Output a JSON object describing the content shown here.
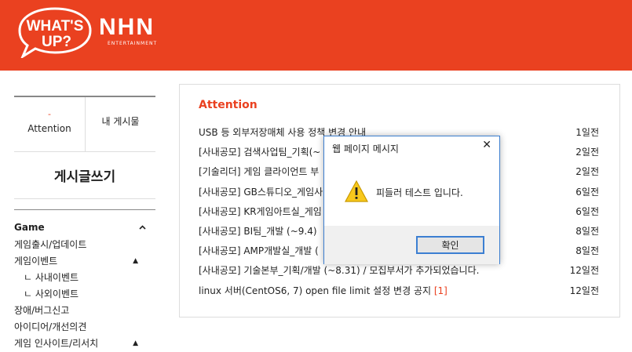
{
  "header": {
    "logo_text_1": "WHAT'S",
    "logo_text_2": "UP?",
    "nhn_logo": "NHN",
    "nhn_sub": "ENTERTAINMENT",
    "brand_color": "#ea4120"
  },
  "sidebar": {
    "tabs": [
      {
        "label": "Attention",
        "marker": "-"
      },
      {
        "label": "내 게시물"
      }
    ],
    "write_label": "게시글쓰기",
    "menu_head": "Game",
    "items": [
      {
        "label": "게임출시/업데이트"
      },
      {
        "label": "게임이벤트",
        "caret": "▲"
      },
      {
        "label": "ㄴ 사내이벤트"
      },
      {
        "label": "ㄴ 사외이벤트"
      },
      {
        "label": "장애/버그신고"
      },
      {
        "label": "아이디어/개선의견"
      },
      {
        "label": "게임 인사이트/리서치",
        "caret": "▲"
      }
    ]
  },
  "main": {
    "title": "Attention",
    "posts": [
      {
        "title": "USB 등 외부저장매체 사용 정책 변경 안내",
        "count": "",
        "date": "1일전"
      },
      {
        "title": "[사내공모] 검색사업팀_기획(~",
        "count": "",
        "date": "2일전"
      },
      {
        "title": "[기술리더] 게임 클라이언트 부",
        "count": "",
        "date": "2일전"
      },
      {
        "title": "[사내공모] GB스튜디오_게임사",
        "count": "",
        "date": "6일전"
      },
      {
        "title": "[사내공모] KR게임아트실_게임",
        "count": "",
        "date": "6일전"
      },
      {
        "title": "[사내공모] BI팀_개발 (~9.4)",
        "count": "",
        "date": "8일전"
      },
      {
        "title": "[사내공모] AMP개발실_개발 (",
        "count": "",
        "date": "8일전"
      },
      {
        "title": "[사내공모] 기술본부_기획/개발 (~8.31) / 모집부서가 추가되었습니다.",
        "count": "",
        "date": "12일전"
      },
      {
        "title": "linux 서버(CentOS6, 7) open file limit 설정 변경 공지",
        "count": "[1]",
        "date": "12일전"
      }
    ]
  },
  "dialog": {
    "title": "웹 페이지 메시지",
    "close": "✕",
    "message": "피들러 테스트 입니다.",
    "ok_label": "확인"
  }
}
